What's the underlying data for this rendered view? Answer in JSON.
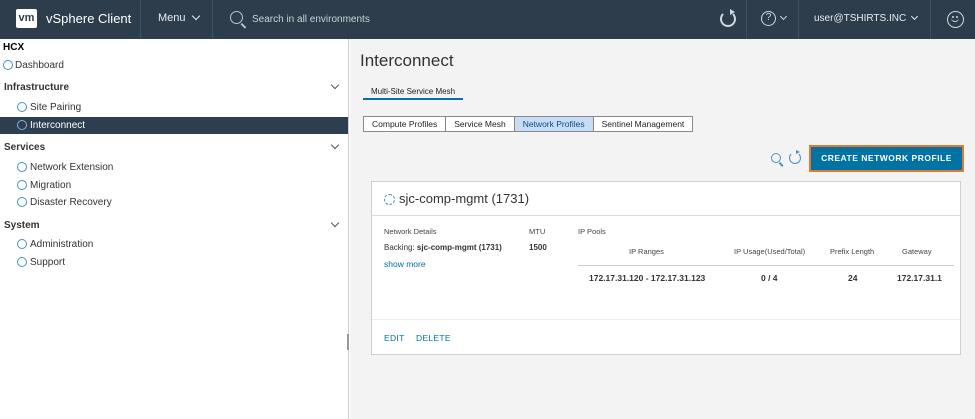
{
  "header": {
    "logo": "vm",
    "app_title": "vSphere Client",
    "menu_label": "Menu",
    "search_placeholder": "Search in all environments",
    "user_label": "user@TSHIRTS.INC",
    "help_glyph": "?"
  },
  "sidebar": {
    "root": "HCX",
    "dashboard": "Dashboard",
    "sections": [
      {
        "label": "Infrastructure",
        "items": [
          "Site Pairing",
          "Interconnect"
        ]
      },
      {
        "label": "Services",
        "items": [
          "Network Extension",
          "Migration",
          "Disaster Recovery"
        ]
      },
      {
        "label": "System",
        "items": [
          "Administration",
          "Support"
        ]
      }
    ]
  },
  "main": {
    "title": "Interconnect",
    "subtab": "Multi-Site Service Mesh",
    "tabs": [
      "Compute Profiles",
      "Service Mesh",
      "Network Profiles",
      "Sentinel Management"
    ],
    "active_tab": "Network Profiles",
    "create_button": "CREATE NETWORK PROFILE",
    "card": {
      "title": "sjc-comp-mgmt (1731)",
      "network_details_label": "Network Details",
      "backing_label": "Backing:",
      "backing_value": "sjc-comp-mgmt (1731)",
      "show_more": "show more",
      "mtu_label": "MTU",
      "mtu_value": "1500",
      "ip_pools_label": "IP Pools",
      "ip_headers": [
        "IP Ranges",
        "IP Usage(Used/Total)",
        "Prefix Length",
        "Gateway"
      ],
      "ip_row": [
        "172.17.31.120 - 172.17.31.123",
        "0 / 4",
        "24",
        "172.17.31.1"
      ],
      "edit": "EDIT",
      "delete": "DELETE"
    }
  },
  "colors": {
    "header_bg": "#2d3d4c",
    "active_sidebar_bg": "#2c3e50",
    "primary": "#0072a3",
    "highlight_outline": "#e07a2e"
  }
}
